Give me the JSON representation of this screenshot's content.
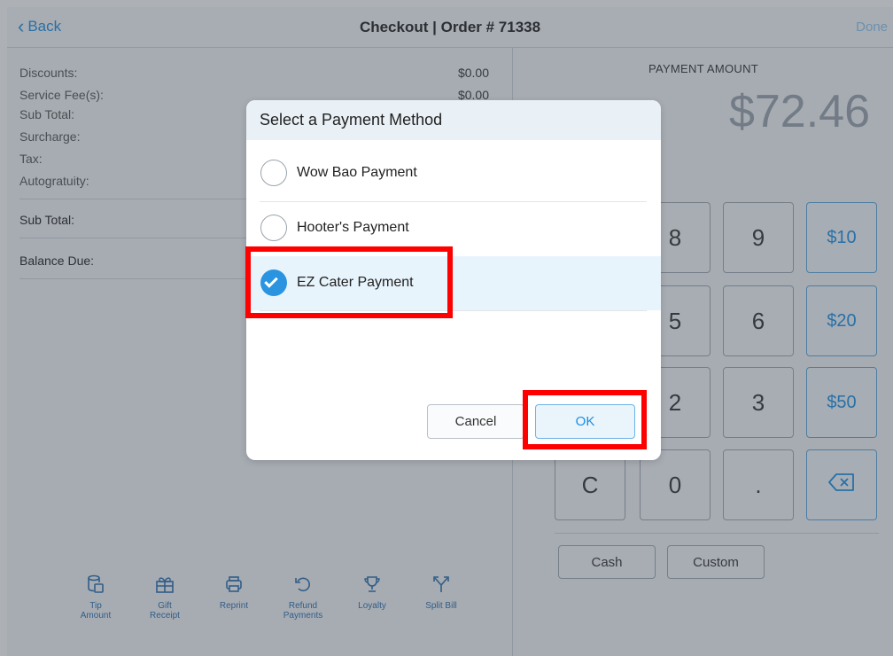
{
  "nav": {
    "back_label": "Back",
    "title": "Checkout | Order # 71338",
    "done_label": "Done"
  },
  "summary": {
    "rows": [
      {
        "label": "Discounts:",
        "amount": "$0.00"
      },
      {
        "label": "Service Fee(s):",
        "amount": "$0.00"
      },
      {
        "label": "Sub Total:",
        "amount": ""
      },
      {
        "label": "Surcharge:",
        "amount": ""
      },
      {
        "label": "Tax:",
        "amount": ""
      },
      {
        "label": "Autogratuity:",
        "amount": ""
      }
    ],
    "sub_total_label": "Sub Total:",
    "balance_due_label": "Balance Due:"
  },
  "actions": [
    {
      "label": "Tip\nAmount",
      "icon": "coins-icon"
    },
    {
      "label": "Gift\nReceipt",
      "icon": "gift-icon"
    },
    {
      "label": "Reprint",
      "icon": "printer-icon"
    },
    {
      "label": "Refund\nPayments",
      "icon": "refund-icon"
    },
    {
      "label": "Loyalty",
      "icon": "trophy-icon"
    },
    {
      "label": "Split Bill",
      "icon": "split-icon"
    }
  ],
  "payment": {
    "label": "PAYMENT AMOUNT",
    "amount": "$72.46",
    "keys": {
      "k8": "8",
      "k9": "9",
      "k10": "$10",
      "k5": "5",
      "k6": "6",
      "k20": "$20",
      "k2": "2",
      "k3": "3",
      "k50": "$50",
      "kc": "C",
      "k0": "0",
      "kdot": ".",
      "kdel": "⌫"
    },
    "cash_label": "Cash",
    "custom_label": "Custom"
  },
  "modal": {
    "title": "Select a Payment Method",
    "options": [
      {
        "label": "Wow Bao Payment",
        "selected": false
      },
      {
        "label": "Hooter's Payment",
        "selected": false
      },
      {
        "label": "EZ Cater Payment",
        "selected": true
      }
    ],
    "cancel_label": "Cancel",
    "ok_label": "OK"
  },
  "colors": {
    "accent": "#1a8fe3",
    "highlight": "#ff0000",
    "selected_bg": "#e8f4fc"
  }
}
